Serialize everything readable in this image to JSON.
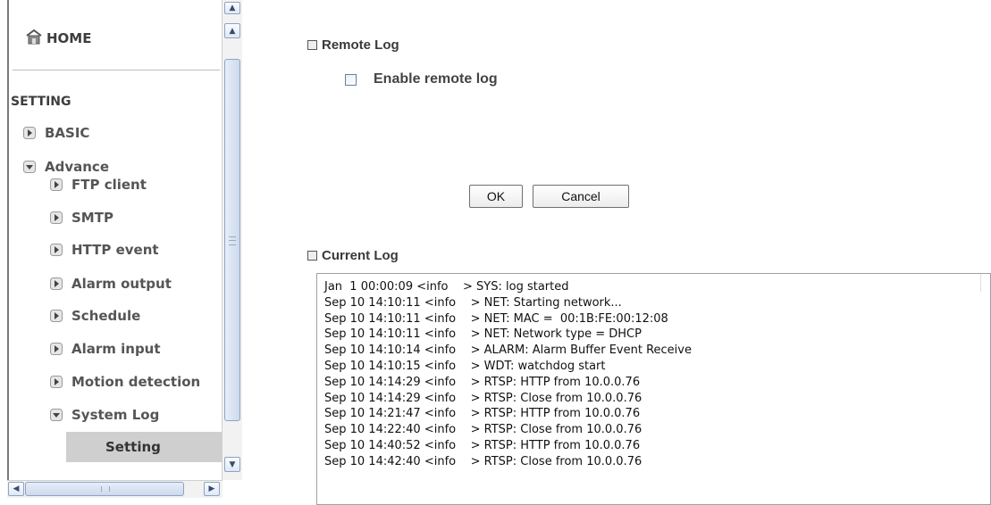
{
  "nav": {
    "home_label": "HOME",
    "setting_header": "SETTING",
    "basic_label": "BASIC",
    "advance_label": "Advance",
    "advance_items": [
      {
        "label": "FTP client"
      },
      {
        "label": "SMTP"
      },
      {
        "label": "HTTP event"
      },
      {
        "label": "Alarm output"
      },
      {
        "label": "Schedule"
      },
      {
        "label": "Alarm input"
      },
      {
        "label": "Motion detection"
      },
      {
        "label": "System Log"
      }
    ],
    "system_log_selected_sub": "Setting"
  },
  "remote_log": {
    "section_title": "Remote Log",
    "enable_checkbox_label": "Enable remote log",
    "enable_checked": false
  },
  "buttons": {
    "ok_label": "OK",
    "cancel_label": "Cancel"
  },
  "current_log": {
    "section_title": "Current Log",
    "lines": [
      "Jan  1 00:00:09 <info    > SYS: log started",
      "Sep 10 14:10:11 <info    > NET: Starting network...",
      "Sep 10 14:10:11 <info    > NET: MAC =  00:1B:FE:00:12:08",
      "Sep 10 14:10:11 <info    > NET: Network type = DHCP",
      "Sep 10 14:10:14 <info    > ALARM: Alarm Buffer Event Receive",
      "Sep 10 14:10:15 <info    > WDT: watchdog start",
      "Sep 10 14:14:29 <info    > RTSP: HTTP from 10.0.0.76",
      "Sep 10 14:14:29 <info    > RTSP: Close from 10.0.0.76",
      "Sep 10 14:21:47 <info    > RTSP: HTTP from 10.0.0.76",
      "Sep 10 14:22:40 <info    > RTSP: Close from 10.0.0.76",
      "Sep 10 14:40:52 <info    > RTSP: HTTP from 10.0.0.76",
      "Sep 10 14:42:40 <info    > RTSP: Close from 10.0.0.76"
    ]
  },
  "icons": {
    "home": "home-icon",
    "collapsed": "triangle-right-icon",
    "expanded": "triangle-down-icon"
  }
}
